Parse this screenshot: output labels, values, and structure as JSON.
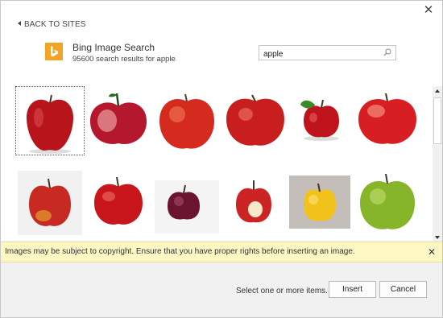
{
  "nav": {
    "back_label": "BACK TO SITES"
  },
  "source": {
    "icon": "bing-logo",
    "title": "Bing Image Search",
    "subtitle": "95600 search results for apple"
  },
  "search": {
    "value": "apple",
    "icon": "search-icon"
  },
  "results": [
    {
      "label": "apple image 1",
      "selected": true,
      "color": "#b8141b"
    },
    {
      "label": "apple image 2",
      "selected": false,
      "color": "#b5182e"
    },
    {
      "label": "apple image 3",
      "selected": false,
      "color": "#d52a1e"
    },
    {
      "label": "apple image 4",
      "selected": false,
      "color": "#c81e1e"
    },
    {
      "label": "apple image 5",
      "selected": false,
      "color": "#c0141c"
    },
    {
      "label": "apple image 6",
      "selected": false,
      "color": "#d71e22"
    },
    {
      "label": "apple image 7",
      "selected": false,
      "color": "#c62a22"
    },
    {
      "label": "apple image 8",
      "selected": false,
      "color": "#c8161c"
    },
    {
      "label": "apple image 9",
      "selected": false,
      "color": "#6a1430"
    },
    {
      "label": "apple image 10",
      "selected": false,
      "color": "#cc2424"
    },
    {
      "label": "apple image 11",
      "selected": false,
      "color": "#f0c21a"
    },
    {
      "label": "apple image 12",
      "selected": false,
      "color": "#86b52a"
    }
  ],
  "notice": {
    "text": "Images may be subject to copyright. Ensure that you have proper rights before inserting an image."
  },
  "footer": {
    "status": "Select one or more items.",
    "insert_label": "Insert",
    "cancel_label": "Cancel"
  },
  "colors": {
    "accent": "#f3a325",
    "notice_bg": "#fdf7c4",
    "footer_bg": "#f1f1f1"
  }
}
